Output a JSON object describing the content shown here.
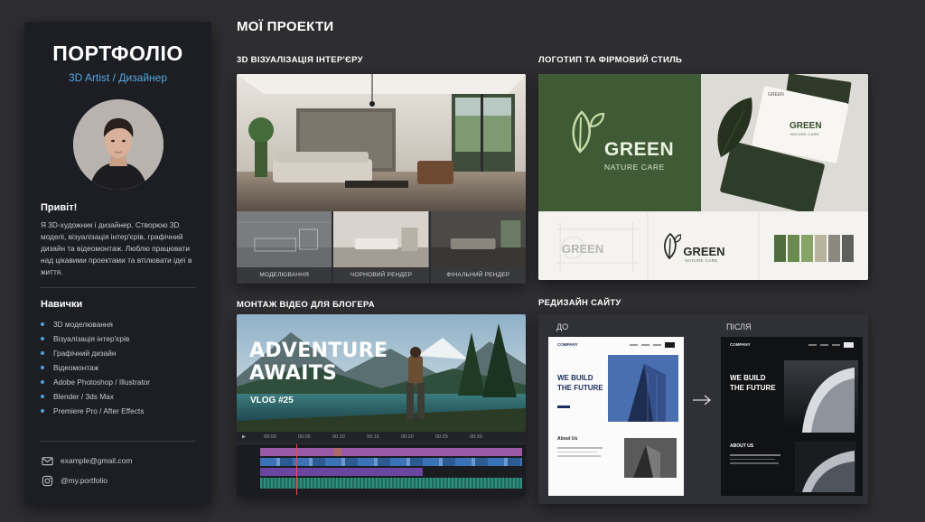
{
  "sidebar": {
    "title": "ПОРТФОЛІО",
    "role": "3D Artist / Дизайнер",
    "greeting": "Привіт!",
    "bio": "Я 3D-художник і дизайнер. Створюю 3D моделі, візуалізація інтер'єрів, графічний дизайн та відеомонтаж. Люблю працювати над цікавими проектами та втілювати ідеї в життя.",
    "skills_heading": "Навички",
    "skills": [
      "3D моделювання",
      "Візуалізація інтер'єрів",
      "Графічний дизайн",
      "Відеомонтаж",
      "Adobe Photoshop / Illustrator",
      "Blender / 3ds Max",
      "Premiere Pro / After Effects"
    ],
    "email": "example@gmail.com",
    "instagram": "@my.portfolio",
    "accent_color": "#4fa2db"
  },
  "main": {
    "title": "МОЇ ПРОЕКТИ",
    "projects": {
      "interior": {
        "label": "3D ВІЗУАЛІЗАЦІЯ ІНТЕР'ЄРУ",
        "stages": [
          "МОДЕЛЮВАННЯ",
          "ЧОРНОВИЙ РЕНДЕР",
          "ФІНАЛЬНИЙ РЕНДЕР"
        ]
      },
      "branding": {
        "label": "ЛОГОТИП ТА ФІРМОВИЙ СТИЛЬ",
        "brand_name": "GREEN",
        "brand_tagline": "NATURE CARE",
        "palette": [
          "#4f6e3c",
          "#6a8a4f",
          "#86a465",
          "#b8b39f",
          "#8b8880",
          "#5f5f5c"
        ]
      },
      "video": {
        "label": "МОНТАЖ ВІДЕО ДЛЯ БЛОГЕРА",
        "headline_line1": "ADVENTURE",
        "headline_line2": "AWAITS",
        "episode": "VLOG #25",
        "timecodes": [
          "00:00",
          "00:05",
          "00:10",
          "00:15",
          "00:20",
          "00:25",
          "00:30"
        ]
      },
      "website": {
        "label": "РЕДИЗАЙН САЙТУ",
        "before_label": "ДО",
        "after_label": "ПІСЛЯ",
        "company": "COMPANY",
        "headline_line1": "WE BUILD",
        "headline_line2": "THE FUTURE",
        "about_before": "About Us",
        "about_after": "ABOUT US"
      }
    }
  }
}
